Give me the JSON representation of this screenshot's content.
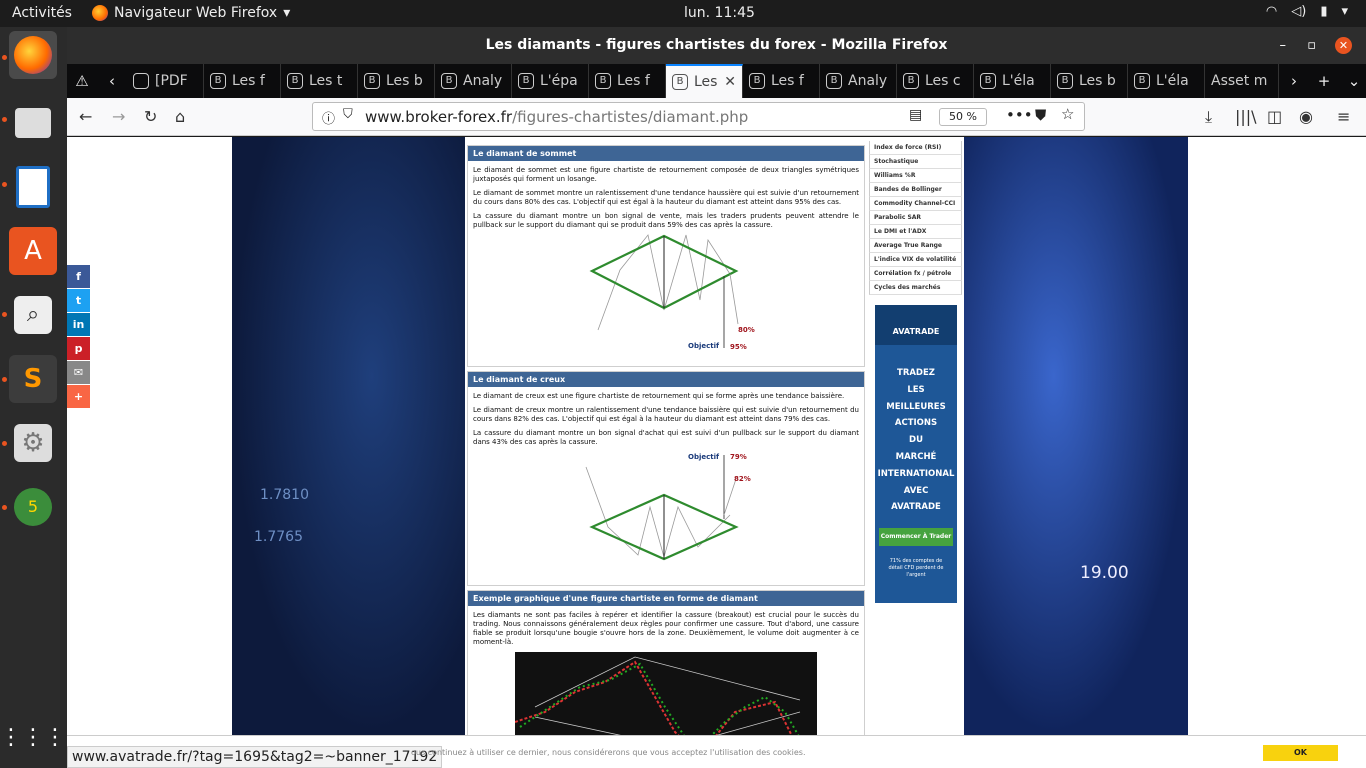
{
  "top": {
    "activities": "Activités",
    "app": "Navigateur Web Firefox",
    "clock": "lun. 11:45"
  },
  "window": {
    "title": "Les diamants - figures chartistes du forex - Mozilla Firefox"
  },
  "tabs": [
    "[PDF",
    "Les f",
    "Les t",
    "Les b",
    "Analy",
    "L'épa",
    "Les f",
    "Les",
    "Les f",
    "Analy",
    "Les c",
    "L'éla",
    "Les b",
    "L'éla",
    "Asset m"
  ],
  "url": {
    "domain": "www.broker-forex.fr",
    "path": "/figures-chartistes/diamant.php",
    "zoom": "50 %"
  },
  "panels": [
    {
      "title": "Le diamant de sommet",
      "p": [
        "Le diamant de sommet est une figure chartiste de retournement composée de deux triangles symétriques juxtaposés qui forment un losange.",
        "Le diamant de sommet montre un ralentissement d'une tendance haussière qui est suivie d'un retournement du cours dans 80% des cas. L'objectif qui est égal à la hauteur du diamant est atteint dans 95% des cas.",
        "La cassure du diamant montre un bon signal de vente, mais les traders prudents peuvent attendre le pullback sur le support du diamant qui se produit dans 59% des cas après la cassure."
      ],
      "lbl": {
        "objectif": "Objectif",
        "a": "80%",
        "b": "95%"
      }
    },
    {
      "title": "Le diamant de creux",
      "p": [
        "Le diamant de creux est une figure chartiste de retournement qui se forme après une tendance baissière.",
        "Le diamant de creux montre un ralentissement d'une tendance baissière qui est suivie d'un retournement du cours dans 82% des cas. L'objectif qui est égal à la hauteur du diamant est atteint dans 79% des cas.",
        "La cassure du diamant montre un bon signal d'achat qui est suivi d'un pullback sur le support du diamant dans 43% des cas après la cassure."
      ],
      "lbl": {
        "objectif": "Objectif",
        "a": "79%",
        "b": "82%"
      }
    },
    {
      "title": "Exemple graphique d'une figure chartiste en forme de diamant",
      "p": [
        "Les diamants ne sont pas faciles à repérer et identifier la cassure (breakout) est crucial pour le succès du trading. Nous connaissons généralement deux règles pour confirmer une cassure. Tout d'abord, une cassure fiable se produit lorsqu'une bougie s'ouvre hors de la zone. Deuxièmement, le volume doit augmenter à ce moment-là."
      ]
    }
  ],
  "sidebar": [
    "Index de force (RSI)",
    "Stochastique",
    "Williams %R",
    "Bandes de Bollinger",
    "Commodity Channel-CCI",
    "Parabolic SAR",
    "Le DMI et l'ADX",
    "Average True Range",
    "L'indice VIX de volatilité",
    "Corrélation fx / pétrole",
    "Cycles des marchés"
  ],
  "ad": {
    "brand": "AVATRADE",
    "lines": [
      "TRADEZ",
      "LES",
      "MEILLEURES",
      "ACTIONS",
      "DU",
      "MARCHÉ",
      "INTERNATIONAL",
      "AVEC",
      "AVATRADE"
    ],
    "cta": "Commencer À Trader",
    "disc": "71% des comptes de détail CFD perdent de l'argent"
  },
  "bg": {
    "r": "19.00",
    "l1": "1.7765",
    "l2": "1.7810"
  },
  "status": {
    "link": "www.avatrade.fr/?tag=1695&tag2=~banner_17192",
    "cookie": "ous continuez à utiliser ce dernier, nous considérerons que vous acceptez l'utilisation des cookies.",
    "ok": "OK"
  }
}
